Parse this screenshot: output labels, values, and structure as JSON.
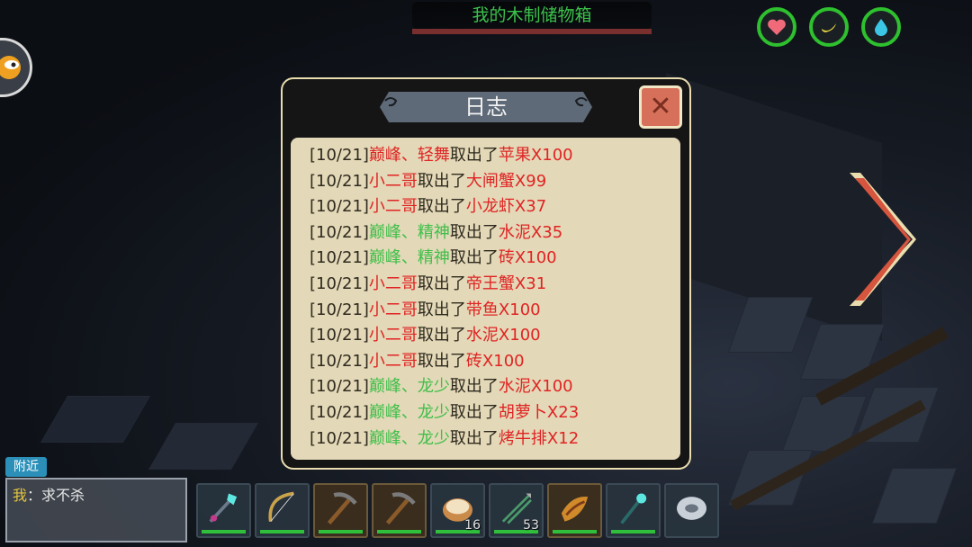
{
  "storage": {
    "title": "我的木制储物箱"
  },
  "stats": {
    "health_icon": "heart-icon",
    "hunger_icon": "banana-icon",
    "thirst_icon": "water-drop-icon",
    "ring_color": "#2ec02e"
  },
  "dialog": {
    "title": "日志",
    "close_label": "✕",
    "log": [
      {
        "date": "[10/21]",
        "user": "巅峰、轻舞",
        "user_color": "red",
        "action": "取出了",
        "item": "苹果X100"
      },
      {
        "date": "[10/21]",
        "user": "小二哥",
        "user_color": "red",
        "action": "取出了",
        "item": "大闸蟹X99"
      },
      {
        "date": "[10/21]",
        "user": "小二哥",
        "user_color": "red",
        "action": "取出了",
        "item": "小龙虾X37"
      },
      {
        "date": "[10/21]",
        "user": "巅峰、精神",
        "user_color": "green",
        "action": "取出了",
        "item": "水泥X35"
      },
      {
        "date": "[10/21]",
        "user": "巅峰、精神",
        "user_color": "green",
        "action": "取出了",
        "item": "砖X100"
      },
      {
        "date": "[10/21]",
        "user": "小二哥",
        "user_color": "red",
        "action": "取出了",
        "item": "帝王蟹X31"
      },
      {
        "date": "[10/21]",
        "user": "小二哥",
        "user_color": "red",
        "action": "取出了",
        "item": "带鱼X100"
      },
      {
        "date": "[10/21]",
        "user": "小二哥",
        "user_color": "red",
        "action": "取出了",
        "item": "水泥X100"
      },
      {
        "date": "[10/21]",
        "user": "小二哥",
        "user_color": "red",
        "action": "取出了",
        "item": "砖X100"
      },
      {
        "date": "[10/21]",
        "user": "巅峰、龙少",
        "user_color": "green",
        "action": "取出了",
        "item": "水泥X100"
      },
      {
        "date": "[10/21]",
        "user": "巅峰、龙少",
        "user_color": "green",
        "action": "取出了",
        "item": "胡萝卜X23"
      },
      {
        "date": "[10/21]",
        "user": "巅峰、龙少",
        "user_color": "green",
        "action": "取出了",
        "item": "烤牛排X12"
      }
    ]
  },
  "chat": {
    "tab_label": "附近",
    "speaker": "我",
    "separator": "：",
    "message": "求不杀"
  },
  "hotbar": [
    {
      "icon": "magic-wand-icon",
      "count": ""
    },
    {
      "icon": "bow-icon",
      "count": ""
    },
    {
      "icon": "pickaxe-icon",
      "count": ""
    },
    {
      "icon": "pickaxe-icon",
      "count": ""
    },
    {
      "icon": "dumpling-icon",
      "count": "16"
    },
    {
      "icon": "arrows-icon",
      "count": "53"
    },
    {
      "icon": "horn-icon",
      "count": ""
    },
    {
      "icon": "staff-icon",
      "count": ""
    },
    {
      "icon": "disc-icon",
      "count": ""
    }
  ]
}
